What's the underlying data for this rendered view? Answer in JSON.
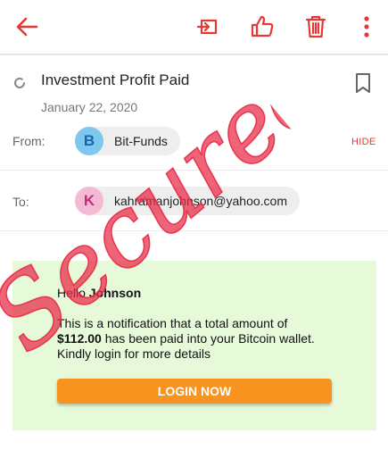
{
  "toolbar": {
    "icons": [
      "back-arrow-icon",
      "move-to-folder-icon",
      "thumbs-up-icon",
      "trash-icon",
      "more-vertical-icon"
    ],
    "accent_color": "#e53935"
  },
  "message": {
    "subject": "Investment Profit Paid",
    "date": "January 22, 2020",
    "from_label": "From:",
    "to_label": "To:",
    "hide_label": "HIDE",
    "sender": {
      "initial": "B",
      "name": "Bit-Funds",
      "avatar_color": "#7ec8f0"
    },
    "recipient": {
      "initial": "K",
      "email": "kahramanjohnson@yahoo.com",
      "avatar_color": "#f6b9d3"
    }
  },
  "body": {
    "greeting_prefix": "Hello ",
    "greeting_name": "Johnson",
    "line1": "This is a notification that a total amount of",
    "amount": "$112.00",
    "line2_rest": " has been paid into your Bitcoin wallet. Kindly login for more details",
    "button_label": "LOGIN NOW",
    "background_color": "#e6fad9",
    "button_color": "#f7931e"
  },
  "watermark": {
    "text": "Secured",
    "color": "#e82844"
  }
}
